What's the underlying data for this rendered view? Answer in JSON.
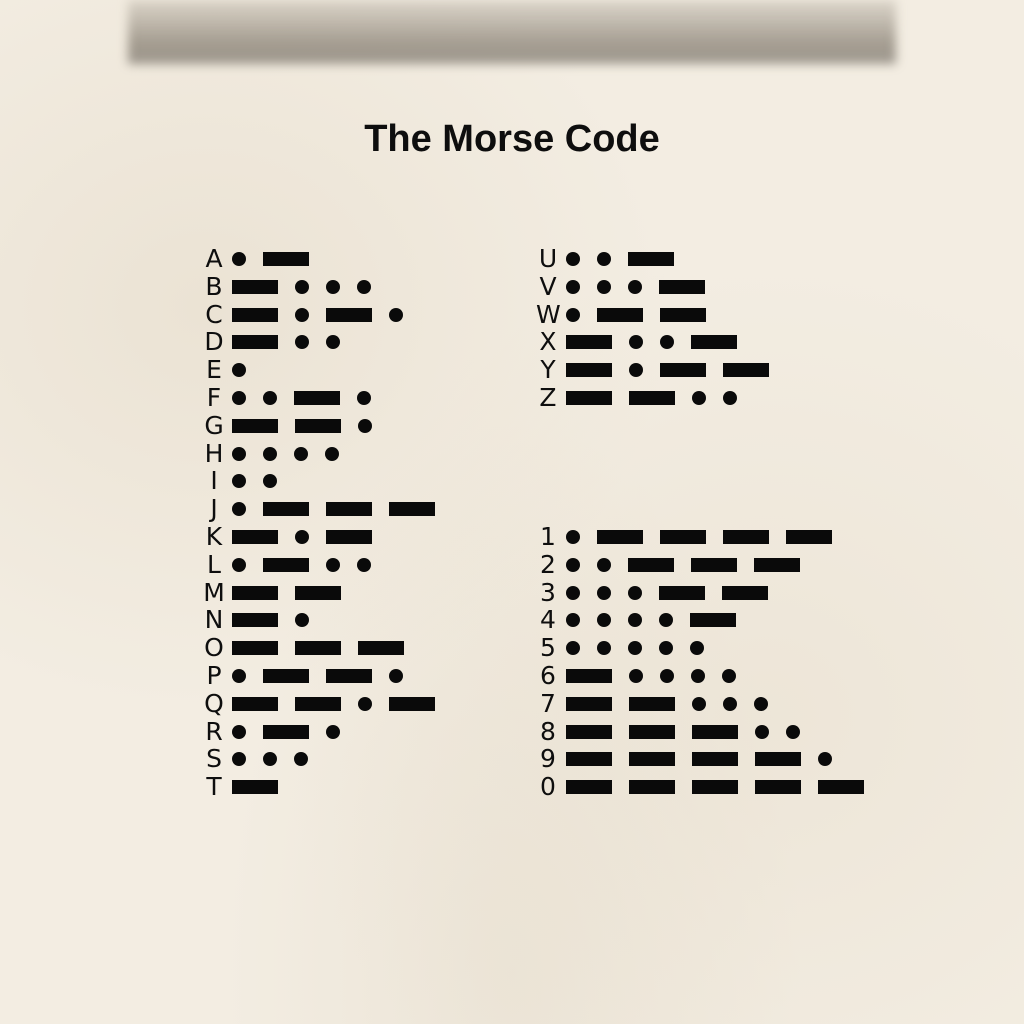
{
  "title": "The Morse Code",
  "letters_left": [
    {
      "char": "A",
      "code": ".-"
    },
    {
      "char": "B",
      "code": "-..."
    },
    {
      "char": "C",
      "code": "-.-."
    },
    {
      "char": "D",
      "code": "-.."
    },
    {
      "char": "E",
      "code": "."
    },
    {
      "char": "F",
      "code": "..-."
    },
    {
      "char": "G",
      "code": "--."
    },
    {
      "char": "H",
      "code": "...."
    },
    {
      "char": "I",
      "code": ".."
    },
    {
      "char": "J",
      "code": ".---"
    },
    {
      "char": "K",
      "code": "-.-"
    },
    {
      "char": "L",
      "code": ".-.."
    },
    {
      "char": "M",
      "code": "--"
    },
    {
      "char": "N",
      "code": "-."
    },
    {
      "char": "O",
      "code": "---"
    },
    {
      "char": "P",
      "code": ".--."
    },
    {
      "char": "Q",
      "code": "--.-"
    },
    {
      "char": "R",
      "code": ".-."
    },
    {
      "char": "S",
      "code": "..."
    },
    {
      "char": "T",
      "code": "-"
    }
  ],
  "letters_right": [
    {
      "char": "U",
      "code": "..-"
    },
    {
      "char": "V",
      "code": "...-"
    },
    {
      "char": "W",
      "code": ".--"
    },
    {
      "char": "X",
      "code": "-..-"
    },
    {
      "char": "Y",
      "code": "-.--"
    },
    {
      "char": "Z",
      "code": "--.."
    }
  ],
  "digits": [
    {
      "char": "1",
      "code": ".----"
    },
    {
      "char": "2",
      "code": "..---"
    },
    {
      "char": "3",
      "code": "...--"
    },
    {
      "char": "4",
      "code": "....-"
    },
    {
      "char": "5",
      "code": "....."
    },
    {
      "char": "6",
      "code": "-...."
    },
    {
      "char": "7",
      "code": "--..."
    },
    {
      "char": "8",
      "code": "---.."
    },
    {
      "char": "9",
      "code": "----."
    },
    {
      "char": "0",
      "code": "-----"
    }
  ]
}
